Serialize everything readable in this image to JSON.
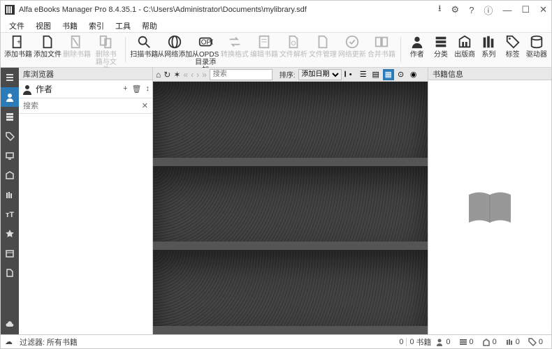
{
  "title": "Alfa eBooks Manager Pro 8.4.35.1 - C:\\Users\\Administrator\\Documents\\mylibrary.sdf",
  "menu": {
    "file": "文件",
    "view": "视图",
    "books": "书籍",
    "index": "索引",
    "tools": "工具",
    "help": "帮助"
  },
  "toolbar": {
    "add_book": "添加书籍",
    "add_file": "添加文件",
    "del_book": "删除书籍",
    "del_book_file": "删除书籍与文件",
    "scan_book": "扫描书籍",
    "add_net": "从网络添加",
    "add_opds": "从OPDS目录添加",
    "convert": "转换格式",
    "edit_book": "编辑书籍",
    "parse_file": "文件解析",
    "file_mgr": "文件管理",
    "net_update": "网络更新",
    "merge": "合并书籍",
    "author": "作者",
    "category": "分类",
    "publisher": "出版商",
    "series": "系列",
    "tags": "标签",
    "drives": "驱动器"
  },
  "leftpanel": {
    "header": "库浏览器",
    "author_label": "作者",
    "search_ph": "搜索"
  },
  "center": {
    "search_ph": "搜索",
    "sort_label": "排序:",
    "sort_value": "添加日期"
  },
  "rightpanel": {
    "header": "书籍信息"
  },
  "status": {
    "filter_label": "过滤器:",
    "filter_value": "所有书籍",
    "count1": "0",
    "count2": "0",
    "books_label": "书籍",
    "stat_author": "0",
    "stat_cat": "0",
    "stat_pub": "0",
    "stat_series": "0",
    "stat_tag": "0"
  }
}
